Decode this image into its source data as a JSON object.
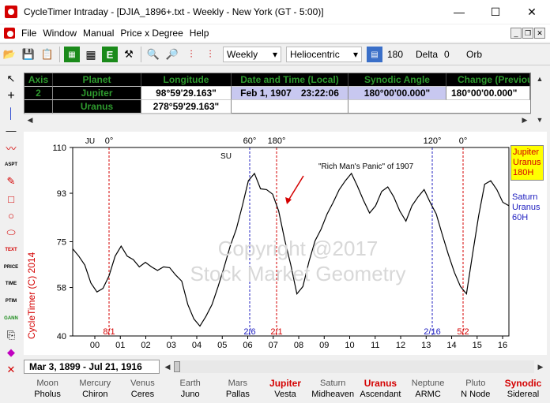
{
  "window": {
    "title": "CycleTimer Intraday - [DJIA_1896+.txt - Weekly - New York (GT - 5:00)]",
    "minimize": "—",
    "maximize": "☐",
    "close": "✕"
  },
  "menu": [
    "File",
    "Window",
    "Manual",
    "Price x Degree",
    "Help"
  ],
  "toolbar": {
    "timeframe": "Weekly",
    "system": "Heliocentric",
    "degrees": "180",
    "delta_label": "Delta",
    "delta_value": "0",
    "orb_label": "Orb"
  },
  "table": {
    "headers": [
      "Axis",
      "Planet",
      "Longitude",
      "Date and Time (Local)",
      "Synodic Angle",
      "Change (Previous Axis)"
    ],
    "rows": [
      {
        "axis": "2",
        "planet": "Jupiter",
        "longitude": "98°59'29.163\"",
        "date": "Feb 1, 1907",
        "time": "23:22:06",
        "synodic": "180°00'00.000\"",
        "change": "180°00'00.000\""
      },
      {
        "axis": "",
        "planet": "Uranus",
        "longitude": "278°59'29.163\"",
        "date": "",
        "time": "",
        "synodic": "",
        "change": ""
      }
    ]
  },
  "chart_data": {
    "type": "line",
    "title": "",
    "ylabel": "",
    "xlabel": "",
    "ylim": [
      40,
      110
    ],
    "yticks": [
      40,
      58,
      75,
      93,
      110
    ],
    "xticks": [
      "00",
      "01",
      "02",
      "03",
      "04",
      "05",
      "06",
      "07",
      "08",
      "09",
      "10",
      "11",
      "12",
      "13",
      "14",
      "15",
      "16"
    ],
    "series": [
      {
        "values": [
          72,
          70,
          66,
          60,
          56,
          58,
          62,
          70,
          73,
          70,
          68,
          66,
          67,
          66,
          64,
          66,
          65,
          63,
          60,
          52,
          46,
          44,
          47,
          52,
          58,
          66,
          73,
          80,
          88,
          98,
          100,
          95,
          94,
          93,
          86,
          76,
          66,
          56,
          58,
          68,
          75,
          80,
          85,
          90,
          94,
          98,
          100,
          96,
          90,
          86,
          88,
          94,
          95,
          92,
          86,
          83,
          88,
          92,
          94,
          90,
          85,
          78,
          70,
          64,
          58,
          56,
          70,
          85,
          96,
          98,
          94,
          90,
          88
        ]
      }
    ],
    "cycle_lines": [
      {
        "top_label": "0°",
        "bottom_label": "8/1",
        "color": "#d40000"
      },
      {
        "top_label": "60°",
        "bottom_label": "2/6",
        "color": "#2020c0"
      },
      {
        "top_label": "180°",
        "bottom_label": "2/1",
        "color": "#d40000"
      },
      {
        "top_label": "120°",
        "bottom_label": "2/16",
        "color": "#2020c0"
      },
      {
        "top_label": "0°",
        "bottom_label": "5/2",
        "color": "#d40000"
      }
    ],
    "planet_markers": [
      "JU",
      "SU"
    ],
    "annotation": "\"Rich Man's Panic\" of 1907",
    "legend": [
      {
        "lines": [
          "Jupiter",
          "Uranus",
          "180H"
        ],
        "color": "#d40000",
        "bg": "#ffff00"
      },
      {
        "lines": [
          "Saturn",
          "Uranus",
          "60H"
        ],
        "color": "#2020c0",
        "bg": "#ffffff"
      }
    ],
    "copyright_side": "CycleTimer (C) 2014",
    "watermark": [
      "Copyright @2017",
      "Stock Market Geometry"
    ]
  },
  "status": {
    "date_range": "Mar 3, 1899  - Jul 21, 1916"
  },
  "bottom_planets": [
    {
      "top": "Moon",
      "bottom": "Pholus",
      "highlight": false
    },
    {
      "top": "Mercury",
      "bottom": "Chiron",
      "highlight": false
    },
    {
      "top": "Venus",
      "bottom": "Ceres",
      "highlight": false
    },
    {
      "top": "Earth",
      "bottom": "Juno",
      "highlight": false
    },
    {
      "top": "Mars",
      "bottom": "Pallas",
      "highlight": false
    },
    {
      "top": "Jupiter",
      "bottom": "Vesta",
      "highlight": true
    },
    {
      "top": "Saturn",
      "bottom": "Midheaven",
      "highlight": false
    },
    {
      "top": "Uranus",
      "bottom": "Ascendant",
      "highlight": true
    },
    {
      "top": "Neptune",
      "bottom": "ARMC",
      "highlight": false
    },
    {
      "top": "Pluto",
      "bottom": "N Node",
      "highlight": false
    },
    {
      "top": "Synodic",
      "bottom": "Sidereal",
      "highlight": true
    }
  ],
  "colors": {
    "accent_red": "#d40000",
    "grid_green": "#000000",
    "selected_row": "#c8c8f0"
  }
}
